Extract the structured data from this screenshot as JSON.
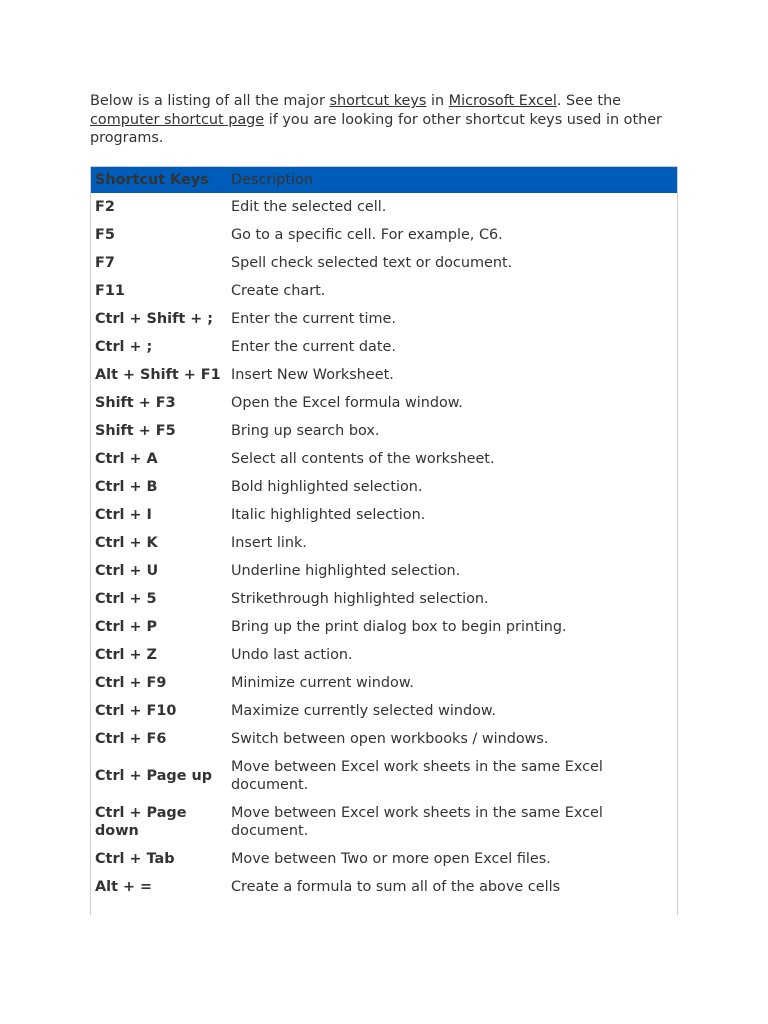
{
  "intro": {
    "t1": "Below is a listing of all the major ",
    "link1": "shortcut keys",
    "t2": " in ",
    "link2": "Microsoft Excel",
    "t3": ". See the ",
    "link3": "computer shortcut page",
    "t4": " if you are looking for other shortcut keys used in other programs."
  },
  "table": {
    "headers": [
      "Shortcut Keys",
      "Description"
    ],
    "rows": [
      [
        "F2",
        "Edit the selected cell."
      ],
      [
        "F5",
        "Go to a specific cell. For example, C6."
      ],
      [
        "F7",
        "Spell check selected text or document."
      ],
      [
        "F11",
        "Create chart."
      ],
      [
        "Ctrl + Shift + ;",
        "Enter the current time."
      ],
      [
        "Ctrl + ;",
        "Enter the current date."
      ],
      [
        "Alt + Shift + F1",
        "Insert New Worksheet."
      ],
      [
        "Shift + F3",
        "Open the Excel formula window."
      ],
      [
        "Shift + F5",
        "Bring up search box."
      ],
      [
        "Ctrl + A",
        "Select all contents of the worksheet."
      ],
      [
        "Ctrl + B",
        "Bold highlighted selection."
      ],
      [
        "Ctrl + I",
        "Italic highlighted selection."
      ],
      [
        "Ctrl + K",
        "Insert link."
      ],
      [
        "Ctrl + U",
        "Underline highlighted selection."
      ],
      [
        "Ctrl + 5",
        "Strikethrough highlighted selection."
      ],
      [
        "Ctrl + P",
        "Bring up the print dialog box to begin printing."
      ],
      [
        "Ctrl + Z",
        "Undo last action."
      ],
      [
        "Ctrl + F9",
        "Minimize current window."
      ],
      [
        "Ctrl + F10",
        "Maximize currently selected window."
      ],
      [
        "Ctrl + F6",
        "Switch between open workbooks / windows."
      ],
      [
        "Ctrl + Page up",
        "Move between Excel work sheets in the same Excel document."
      ],
      [
        "Ctrl + Page down",
        "Move between Excel work sheets in the same Excel document."
      ],
      [
        "Ctrl + Tab",
        "Move between Two or more open Excel files."
      ],
      [
        "Alt + =",
        "Create a formula to sum all of the above cells"
      ]
    ]
  }
}
